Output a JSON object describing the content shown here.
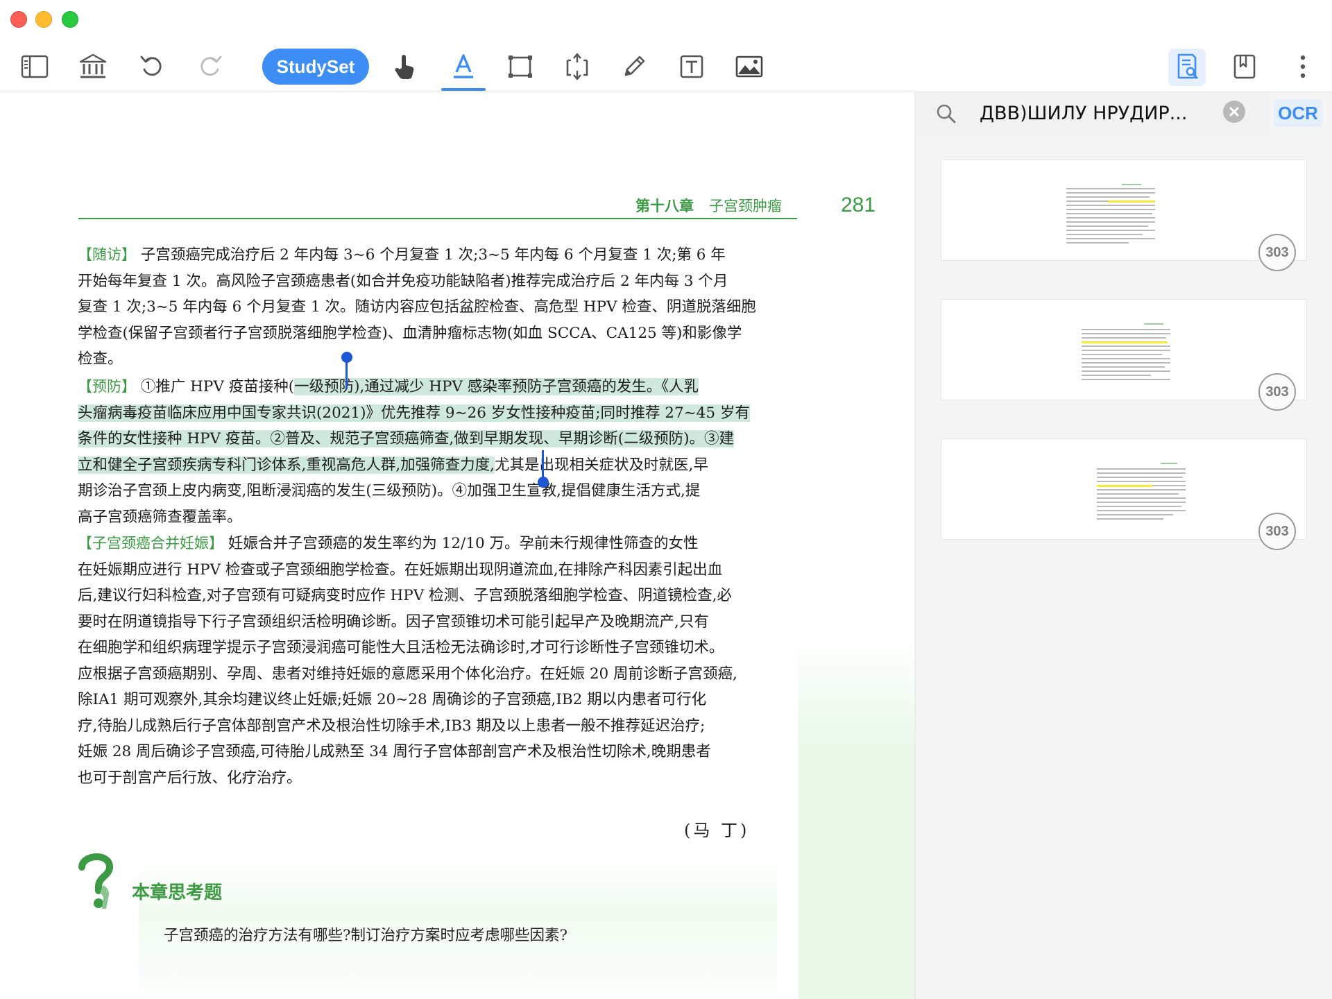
{
  "toolbar": {
    "studyset_label": "StudySet",
    "accent_color": "#3d8df5",
    "icons": [
      "sidebar-toggle-icon",
      "library-icon",
      "undo-icon",
      "redo-icon",
      "hand-pan-icon",
      "text-highlight-icon",
      "select-area-icon",
      "crop-icon",
      "pencil-icon",
      "text-box-icon",
      "image-icon",
      "search-document-icon",
      "bookmark-icon",
      "more-options-icon"
    ]
  },
  "document": {
    "header_chapter": "第十八章",
    "header_title": "子宫颈肿瘤",
    "page_number": "281",
    "brand_green": "#3c9a44",
    "followup": {
      "lead": "【随访】",
      "lines": [
        " 子宫颈癌完成治疗后 2 年内每 3~6 个月复查 1 次;3~5 年内每 6 个月复查 1 次;第 6 年",
        "开始每年复查 1 次。高风险子宫颈癌患者(如合并免疫功能缺陷者)推荐完成治疗后 2 年内每 3 个月",
        "复查 1 次;3~5 年内每 6 个月复查 1 次。随访内容应包括盆腔检查、高危型 HPV 检查、阴道脱落细胞",
        "学检查(保留子宫颈者行子宫颈脱落细胞学检查)、血清肿瘤标志物(如血 SCCA、CA125 等)和影像学",
        "检查。"
      ]
    },
    "prevention": {
      "lead": "【预防】",
      "line1_plain": " ①推广 HPV 疫苗接种(",
      "line1_hl": "一级预防),通过减少 HPV 感染率预防子宫颈癌的发生。《人乳",
      "line2_hl": "头瘤病毒疫苗临床应用中国专家共识(2021)》优先推荐 9~26 岁女性接种疫苗;同时推荐 27~45 岁有",
      "line3_hl": "条件的女性接种 HPV 疫苗。②普及、规范子宫颈癌筛查,做到早期发现、早期诊断(二级预防)。③建",
      "line4_hl": "立和健全子宫颈疾病专科门诊体系,重视高危人群,加强筛查力度,",
      "line4_plain": "尤其是出现相关症状及时就医,早",
      "line5": "期诊治子宫颈上皮内病变,阻断浸润癌的发生(三级预防)。④加强卫生宣教,提倡健康生活方式,提",
      "line6": "高子宫颈癌筛查覆盖率。"
    },
    "pregnancy": {
      "lead": "【子宫颈癌合并妊娠】",
      "lines": [
        " 妊娠合并子宫颈癌的发生率约为 12/10 万。孕前未行规律性筛查的女性",
        "在妊娠期应进行 HPV 检查或子宫颈细胞学检查。在妊娠期出现阴道流血,在排除产科因素引起出血",
        "后,建议行妇科检查,对子宫颈有可疑病变时应作 HPV 检测、子宫颈脱落细胞学检查、阴道镜检查,必",
        "要时在阴道镜指导下行子宫颈组织活检明确诊断。因子宫颈锥切术可能引起早产及晚期流产,只有",
        "在细胞学和组织病理学提示子宫颈浸润癌可能性大且活检无法确诊时,才可行诊断性子宫颈锥切术。",
        "应根据子宫颈癌期别、孕周、患者对维持妊娠的意愿采用个体化治疗。在妊娠 20 周前诊断子宫颈癌,",
        "除ⅠA1 期可观察外,其余均建议终止妊娠;妊娠 20~28 周确诊的子宫颈癌,ⅠB2 期以内患者可行化",
        "疗,待胎儿成熟后行子宫体部剖宫产术及根治性切除手术,ⅠB3 期及以上患者一般不推荐延迟治疗;",
        "妊娠 28 周后确诊子宫颈癌,可待胎儿成熟至 34 周行子宫体部剖宫产术及根治性切除术,晚期患者",
        "也可于剖宫产后行放、化疗治疗。"
      ]
    },
    "signature": "(马 丁)",
    "think_title": "本章思考题",
    "think_question": "子宫颈癌的治疗方法有哪些?制订治疗方案时应考虑哪些因素?"
  },
  "sidebar": {
    "search_query": "ДВВ)ШИЛУ НРУДИР...",
    "ocr_label": "OCR",
    "results": [
      {
        "page_badge": "303"
      },
      {
        "page_badge": "303"
      },
      {
        "page_badge": "303"
      }
    ]
  }
}
